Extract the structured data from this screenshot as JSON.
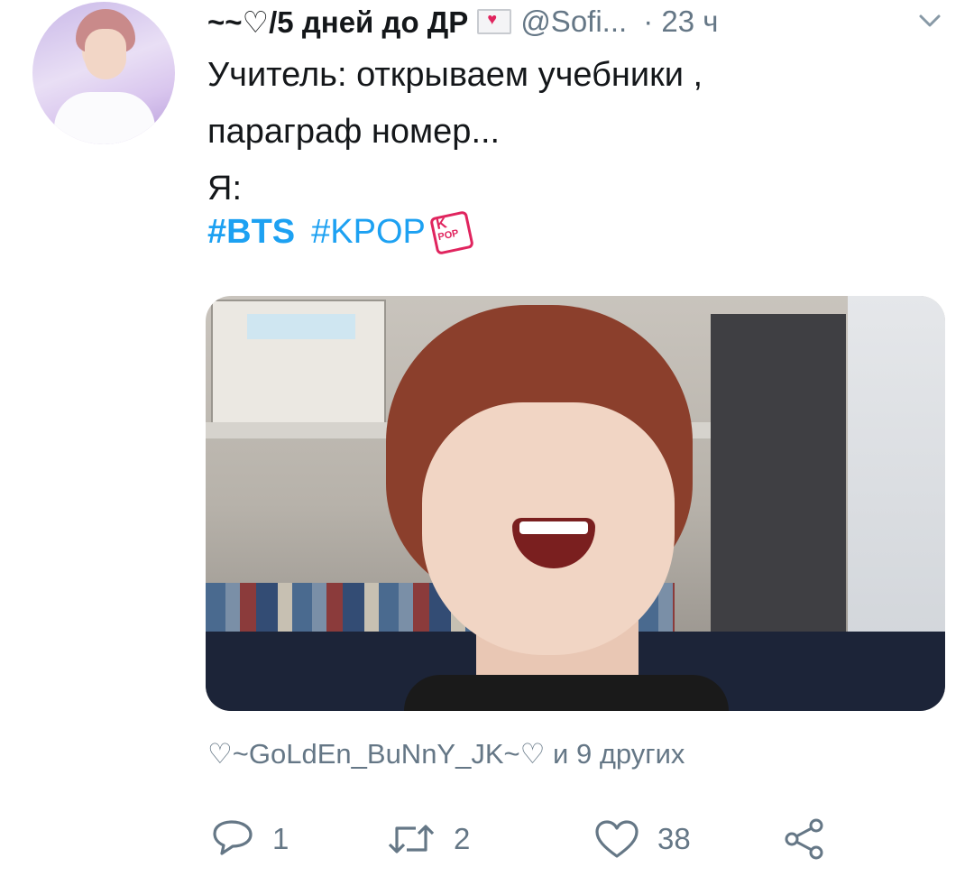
{
  "tweet": {
    "display_name": "~~♡/5 дней до ДР",
    "handle": "@Sofi...",
    "time": "· 23 ч",
    "text_lines": [
      "Учитель: открываем учебники ,",
      "параграф номер...",
      "Я:"
    ],
    "hashtags": [
      "#BTS",
      "#KPOP"
    ],
    "likers_text": "♡~GoLdEn_BuNnY_JK~♡ и 9 других",
    "actions": {
      "reply_count": "1",
      "retweet_count": "2",
      "like_count": "38"
    }
  },
  "colors": {
    "link": "#1da1f2",
    "secondary_text": "#657786",
    "primary_text": "#14171a",
    "heart_red": "#e0245e"
  },
  "icons": {
    "envelope": "love-letter-icon",
    "kpop": "kpop-sticker-icon",
    "caret": "chevron-down-icon",
    "reply": "reply-icon",
    "retweet": "retweet-icon",
    "like": "heart-icon",
    "share": "share-icon"
  }
}
